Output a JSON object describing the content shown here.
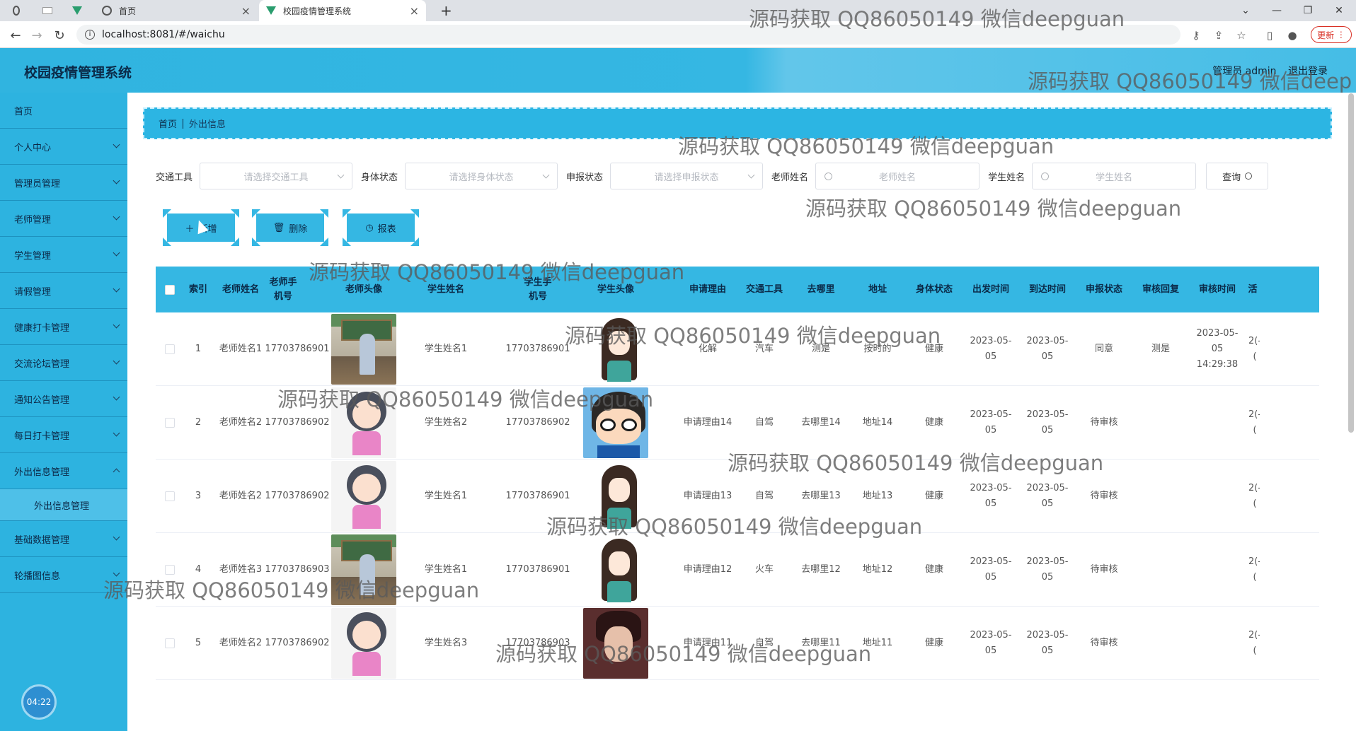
{
  "browser": {
    "tabs": [
      {
        "label": "首页",
        "active": false
      },
      {
        "label": "校园疫情管理系统",
        "active": true
      }
    ],
    "url": "localhost:8081/#/waichu",
    "update_label": "更新",
    "new_tab": "+"
  },
  "app": {
    "title": "校园疫情管理系统",
    "admin_text": "管理员 admin",
    "logout": "退出登录"
  },
  "sidebar": {
    "items": [
      {
        "label": "首页",
        "expandable": false
      },
      {
        "label": "个人中心",
        "expandable": true
      },
      {
        "label": "管理员管理",
        "expandable": true
      },
      {
        "label": "老师管理",
        "expandable": true
      },
      {
        "label": "学生管理",
        "expandable": true
      },
      {
        "label": "请假管理",
        "expandable": true
      },
      {
        "label": "健康打卡管理",
        "expandable": true
      },
      {
        "label": "交流论坛管理",
        "expandable": true
      },
      {
        "label": "通知公告管理",
        "expandable": true
      },
      {
        "label": "每日打卡管理",
        "expandable": true
      },
      {
        "label": "外出信息管理",
        "expandable": true
      },
      {
        "label": "外出信息管理",
        "sub": true
      },
      {
        "label": "基础数据管理",
        "expandable": true
      },
      {
        "label": "轮播图信息",
        "expandable": true
      }
    ],
    "clock": "04:22"
  },
  "breadcrumb": {
    "home": "首页",
    "current": "外出信息"
  },
  "filters": {
    "transport_label": "交通工具",
    "transport_placeholder": "请选择交通工具",
    "health_label": "身体状态",
    "health_placeholder": "请选择身体状态",
    "apply_label": "申报状态",
    "apply_placeholder": "请选择申报状态",
    "teacher_label": "老师姓名",
    "teacher_placeholder": "老师姓名",
    "student_label": "学生姓名",
    "student_placeholder": "学生姓名",
    "query_label": "查询"
  },
  "actions": {
    "add": "新增",
    "delete": "删除",
    "report": "报表"
  },
  "table": {
    "headers": [
      "索引",
      "老师姓名",
      "老师手机号",
      "老师头像",
      "学生姓名",
      "学生手机号",
      "学生头像",
      "申请理由",
      "交通工具",
      "去哪里",
      "地址",
      "身体状态",
      "出发时间",
      "到达时间",
      "申报状态",
      "审核回复",
      "审核时间",
      "活"
    ],
    "rows": [
      {
        "index": "1",
        "teacher": "老师姓名1",
        "tphone": "17703786901",
        "tavatar": "classroom",
        "student": "学生姓名1",
        "sphone": "17703786901",
        "savatar": "anime",
        "reason": "化解",
        "transport": "汽车",
        "where": "测是",
        "address": "按时的",
        "health": "健康",
        "depart": "2023-05-05",
        "arrive": "2023-05-05",
        "status": "同意",
        "reply": "测是",
        "review_time": "2023-05-05 14:29:38",
        "extra": "2(-("
      },
      {
        "index": "2",
        "teacher": "老师姓名2",
        "tphone": "17703786902",
        "tavatar": "girl",
        "student": "学生姓名2",
        "sphone": "17703786902",
        "savatar": "conan",
        "reason": "申请理由14",
        "transport": "自驾",
        "where": "去哪里14",
        "address": "地址14",
        "health": "健康",
        "depart": "2023-05-05",
        "arrive": "2023-05-05",
        "status": "待审核",
        "reply": "",
        "review_time": "",
        "extra": "2(-("
      },
      {
        "index": "3",
        "teacher": "老师姓名2",
        "tphone": "17703786902",
        "tavatar": "girl",
        "student": "学生姓名1",
        "sphone": "17703786901",
        "savatar": "anime",
        "reason": "申请理由13",
        "transport": "自驾",
        "where": "去哪里13",
        "address": "地址13",
        "health": "健康",
        "depart": "2023-05-05",
        "arrive": "2023-05-05",
        "status": "待审核",
        "reply": "",
        "review_time": "",
        "extra": "2(-("
      },
      {
        "index": "4",
        "teacher": "老师姓名3",
        "tphone": "17703786903",
        "tavatar": "classroom",
        "student": "学生姓名1",
        "sphone": "17703786901",
        "savatar": "anime",
        "reason": "申请理由12",
        "transport": "火车",
        "where": "去哪里12",
        "address": "地址12",
        "health": "健康",
        "depart": "2023-05-05",
        "arrive": "2023-05-05",
        "status": "待审核",
        "reply": "",
        "review_time": "",
        "extra": "2(-("
      },
      {
        "index": "5",
        "teacher": "老师姓名2",
        "tphone": "17703786902",
        "tavatar": "girl",
        "student": "学生姓名3",
        "sphone": "17703786903",
        "savatar": "man",
        "reason": "申请理由11",
        "transport": "自驾",
        "where": "去哪里11",
        "address": "地址11",
        "health": "健康",
        "depart": "2023-05-05",
        "arrive": "2023-05-05",
        "status": "待审核",
        "reply": "",
        "review_time": "",
        "extra": "2(-("
      }
    ]
  },
  "watermark": "源码获取 QQ86050149 微信deepguan",
  "watermark_partial": "源码获取 QQ86050149 微信deep"
}
